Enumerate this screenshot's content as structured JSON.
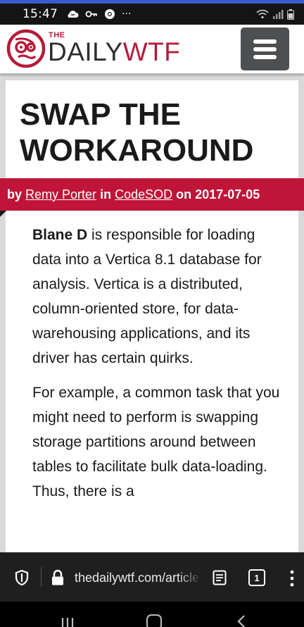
{
  "status_bar": {
    "time": "15:47",
    "left_icons": [
      "cloud-sync-icon",
      "key-icon",
      "chrome-icon",
      "more-dots"
    ],
    "more_dots": "···",
    "right_icons": [
      "wifi-icon",
      "signal-icon",
      "battery-icon"
    ]
  },
  "header": {
    "logo_the": "THE",
    "logo_daily": "DAILY",
    "logo_wtf": "WTF",
    "menu_icon": "hamburger-icon",
    "brand_color": "#b51a3a"
  },
  "article": {
    "title": "SWAP THE WORKAROUND",
    "byline": {
      "by": "by",
      "author": "Remy Porter",
      "in": "in",
      "category": "CodeSOD",
      "on": "on",
      "date": "2017-07-05",
      "ribbon_color": "#c01538"
    },
    "paragraphs": [
      {
        "lead": "Blane D",
        "text": " is responsible for loading data into a Vertica 8.1 database for analysis. Vertica is a distributed, column-oriented store, for data-warehousing applications, and its driver has certain quirks."
      },
      {
        "lead": "",
        "text": "For example, a common task that you might need to perform is swapping storage partitions around between tables to facilitate bulk data-loading. Thus, there is a"
      }
    ]
  },
  "browser": {
    "url": "thedailywtf.com/articles/swap-the-workaround",
    "tab_count": "1",
    "icons": [
      "shield-icon",
      "lock-icon",
      "reader-mode-icon",
      "tabs-icon",
      "more-vert-icon"
    ]
  },
  "nav_bar": {
    "icons": [
      "recent-apps-icon",
      "home-icon",
      "back-icon"
    ]
  }
}
